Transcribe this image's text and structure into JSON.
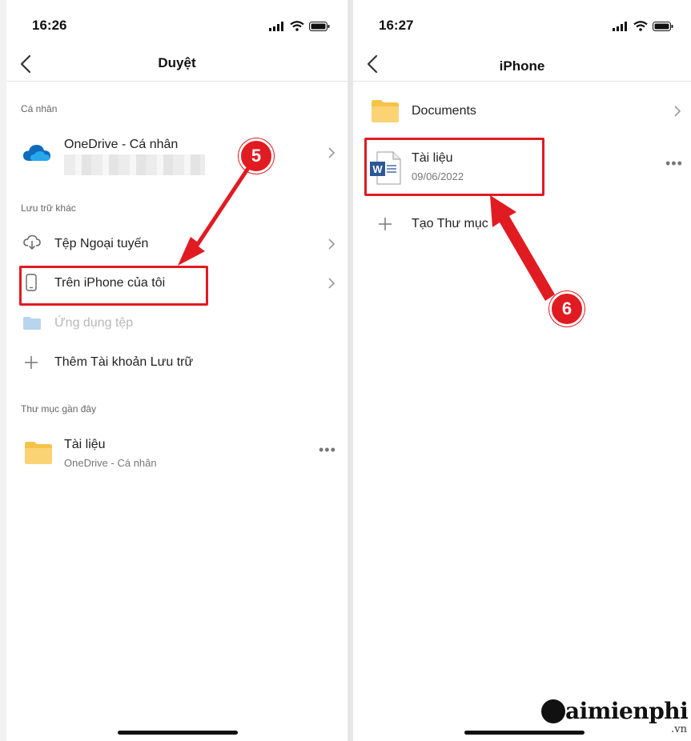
{
  "left_screen": {
    "status_time": "16:26",
    "nav_title": "Duyệt",
    "sections": {
      "personal": "Cá nhân",
      "other_storage": "Lưu trữ khác",
      "recent_folders": "Thư mục gần đây"
    },
    "onedrive": {
      "title": "OneDrive - Cá nhân"
    },
    "items": {
      "offline": "Tệp Ngoại tuyến",
      "on_iphone": "Trên iPhone của tôi",
      "files_app": "Ứng dụng tệp",
      "add_storage": "Thêm Tài khoản Lưu trữ"
    },
    "recent": {
      "title": "Tài liệu",
      "subtitle": "OneDrive - Cá nhân"
    },
    "step_badge": "5"
  },
  "right_screen": {
    "status_time": "16:27",
    "nav_title": "iPhone",
    "folder": {
      "title": "Documents"
    },
    "document": {
      "title": "Tài liệu",
      "date": "09/06/2022",
      "file_badge": "W"
    },
    "create_folder": "Tạo Thư mục",
    "step_badge": "6"
  },
  "watermark": {
    "brand": "aimienphi",
    "suffix": ".vn"
  },
  "colors": {
    "highlight": "#e11b22",
    "onedrive_blue": "#0f6cbd",
    "folder_yellow": "#f6c34a",
    "word_blue": "#2b5797"
  }
}
